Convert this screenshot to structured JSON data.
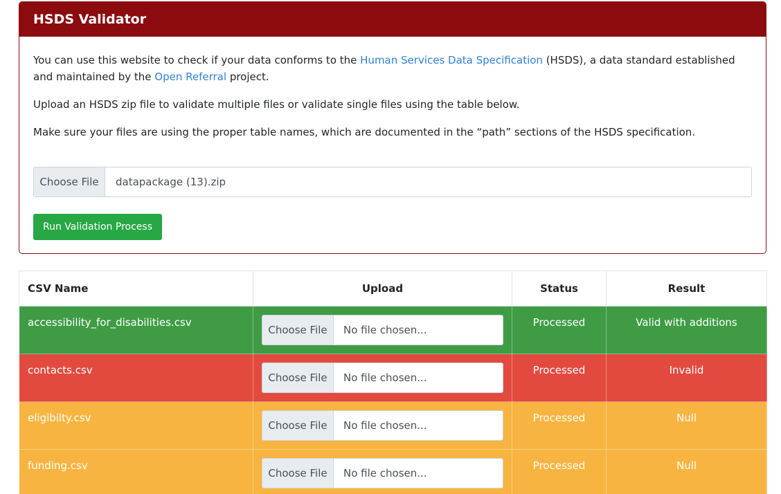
{
  "card": {
    "title": "HSDS Validator",
    "intro_prefix": "You can use this website to check if your data conforms to the ",
    "intro_link1": "Human Services Data Specification",
    "intro_mid": " (HSDS), a data standard established and maintained by the ",
    "intro_link2": "Open Referral",
    "intro_suffix": " project.",
    "para2": "Upload an HSDS zip file to validate multiple files or validate single files using the table below.",
    "para3": "Make sure your files are using the proper table names, which are documented in the “path” sections of the HSDS specification.",
    "file_button": "Choose File",
    "file_name": "datapackage (13).zip",
    "run_button": "Run Validation Process"
  },
  "table": {
    "headers": [
      "CSV Name",
      "Upload",
      "Status",
      "Result"
    ],
    "rows": [
      {
        "name": "accessibility_for_disabilities.csv",
        "choose": "Choose File",
        "file": "No file chosen...",
        "status": "Processed",
        "result": "Valid with additions"
      },
      {
        "name": "contacts.csv",
        "choose": "Choose File",
        "file": "No file chosen...",
        "status": "Processed",
        "result": "Invalid"
      },
      {
        "name": "eligibilty.csv",
        "choose": "Choose File",
        "file": "No file chosen...",
        "status": "Processed",
        "result": "Null"
      },
      {
        "name": "funding.csv",
        "choose": "Choose File",
        "file": "No file chosen...",
        "status": "Processed",
        "result": "Null"
      }
    ]
  },
  "colors": {
    "header": "#8b0b0e",
    "valid": "#3f9c45",
    "invalid": "#e34a3f",
    "null": "#f8b440",
    "button": "#28a745",
    "link": "#2f80d6"
  }
}
